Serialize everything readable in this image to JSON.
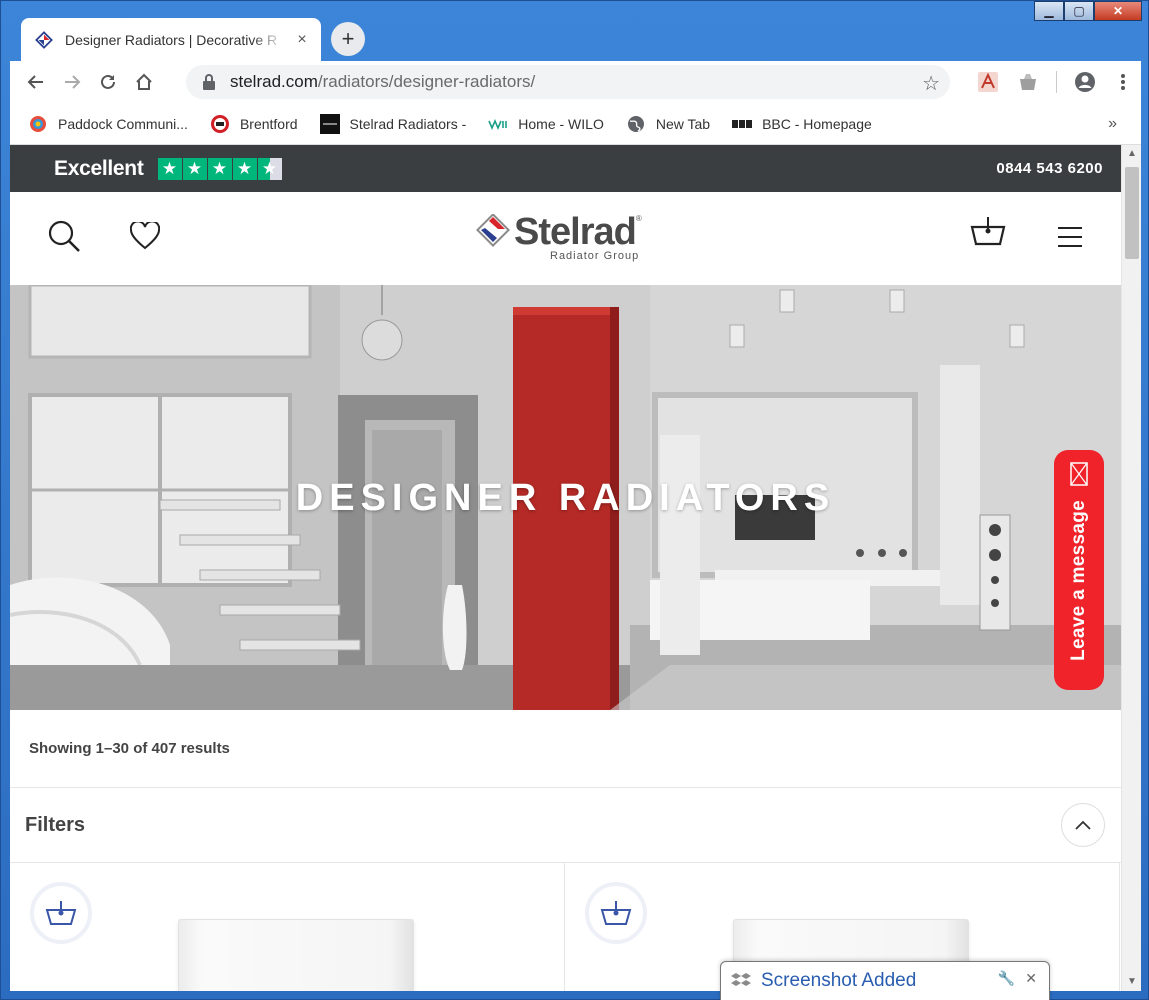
{
  "browser": {
    "tab_title": "Designer Radiators | Decorative R",
    "tab_close": "×",
    "new_tab": "+",
    "url_host": "stelrad.com",
    "url_path": "/radiators/designer-radiators/",
    "window_min": "▁",
    "window_max": "▢",
    "window_close": "✕",
    "bookmarks": [
      {
        "label": "Paddock Communi...",
        "icon": "paddock-icon"
      },
      {
        "label": "Brentford",
        "icon": "brentford-icon"
      },
      {
        "label": "Stelrad Radiators -",
        "icon": "indicoll-icon"
      },
      {
        "label": "Home - WILO",
        "icon": "wilo-icon"
      },
      {
        "label": "New Tab",
        "icon": "globe-icon"
      },
      {
        "label": "BBC - Homepage",
        "icon": "bbc-icon"
      }
    ],
    "bookmarks_more": "»"
  },
  "trustbar": {
    "rating_label": "Excellent",
    "stars": 4.5,
    "phone": "0844 543 6200"
  },
  "header": {
    "logo_text": "Stelrad",
    "logo_reg": "®",
    "logo_sub": "Radiator Group"
  },
  "hero": {
    "title": "DESIGNER RADIATORS"
  },
  "listing": {
    "results_text": "Showing 1–30 of 407 results",
    "filters_label": "Filters"
  },
  "widget": {
    "leave_message": "Leave a message"
  },
  "toast": {
    "text": "Screenshot Added"
  },
  "colors": {
    "accent_red": "#f0232b",
    "trust_green": "#00b67a",
    "trustbar_bg": "#3b3e41",
    "basket_blue": "#3a56a8"
  }
}
